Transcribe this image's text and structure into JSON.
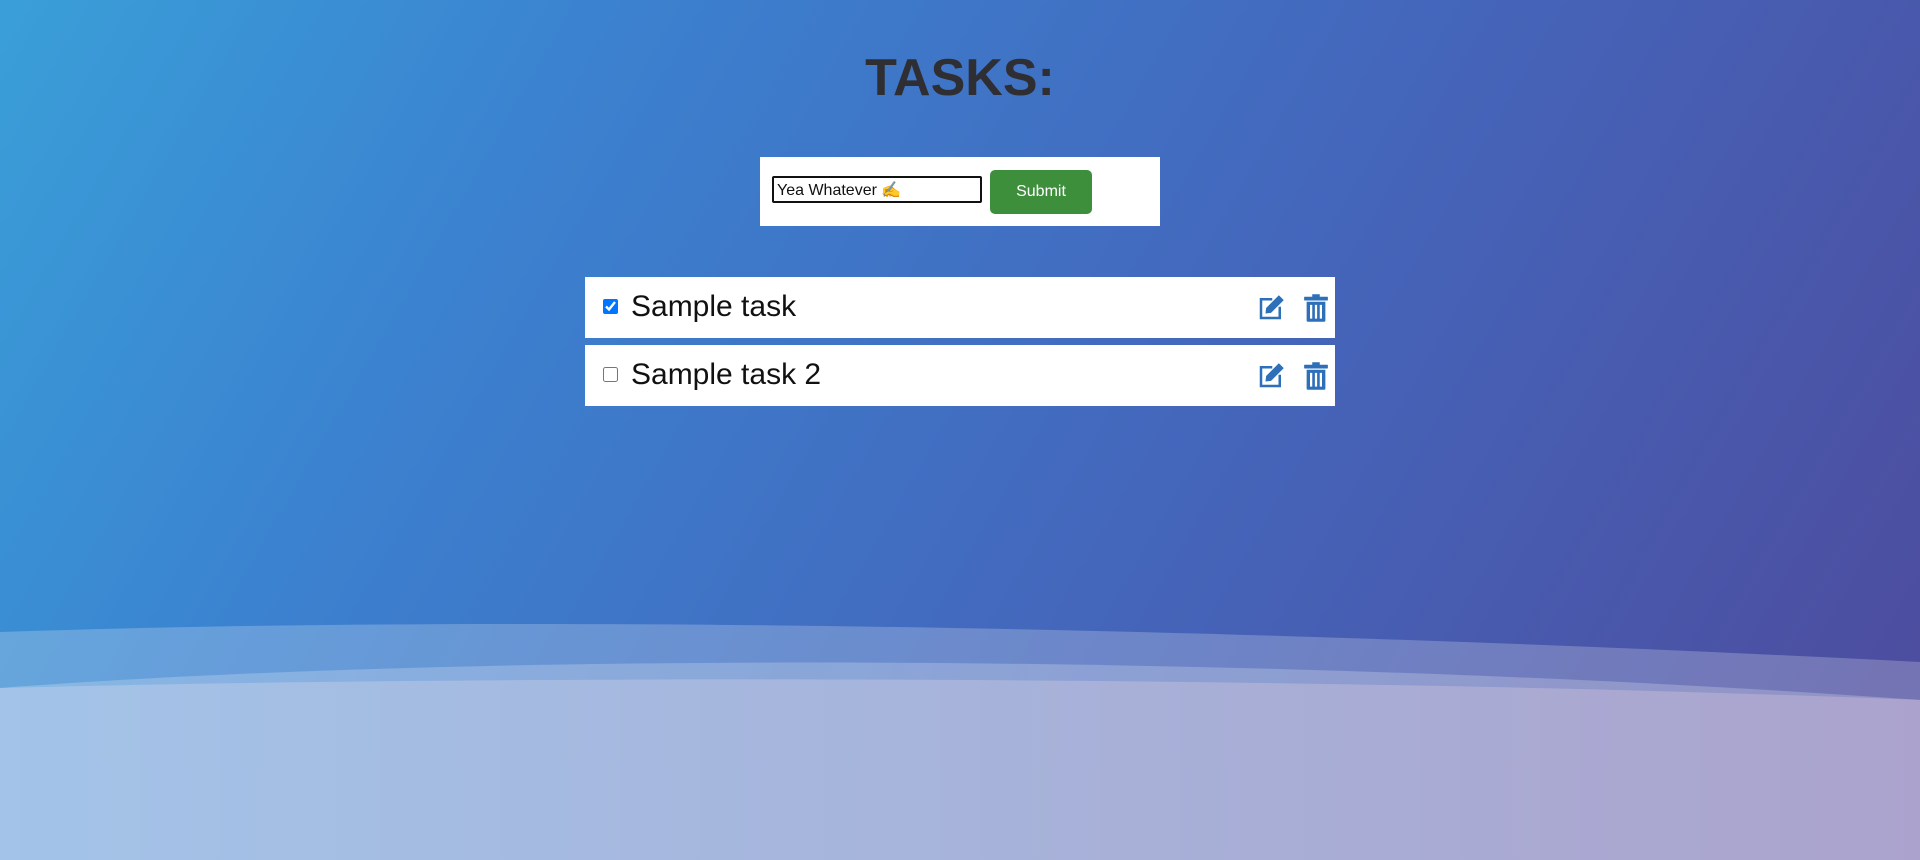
{
  "header": {
    "title": "TASKS:"
  },
  "form": {
    "input_value": "Yea Whatever ✍️",
    "submit_label": "Submit"
  },
  "tasks": [
    {
      "label": "Sample task",
      "completed": true
    },
    {
      "label": "Sample task 2",
      "completed": false
    }
  ],
  "icons": {
    "edit": "edit-icon",
    "delete": "trash-icon"
  },
  "colors": {
    "submit_button": "#3d8f3c",
    "icon_accent": "#2d6fb8",
    "title": "#2f2f33"
  }
}
